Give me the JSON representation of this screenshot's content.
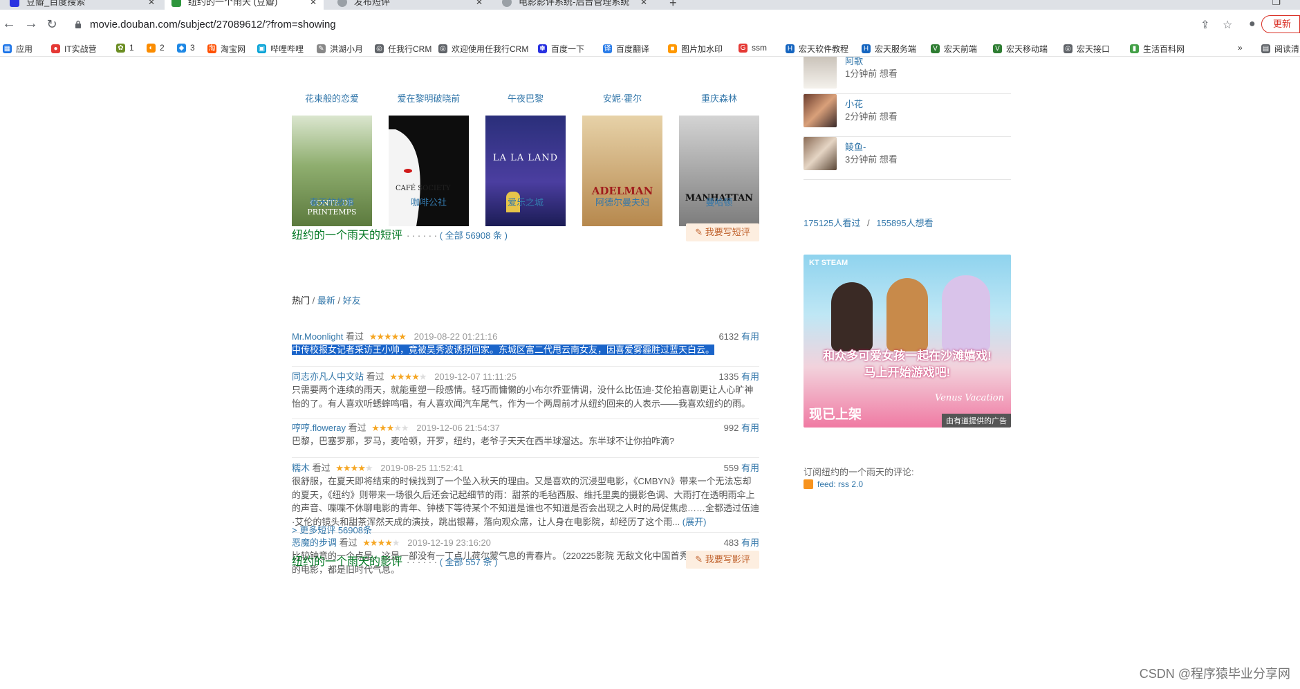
{
  "browser": {
    "tabs": [
      {
        "title": "豆瓣_百度搜索",
        "fav_color": "#2932e1"
      },
      {
        "title": "纽约的一个雨天 (豆瓣)",
        "fav_color": "#2e963d"
      },
      {
        "title": "发布短评",
        "fav_color": "#5f6368"
      },
      {
        "title": "电影影评系统-后台管理系统",
        "fav_color": "#5f6368"
      }
    ],
    "url": "movie.douban.com/subject/27089612/?from=showing",
    "update_label": "更新",
    "bookmarks": [
      {
        "label": "应用",
        "color": "#1a73e8",
        "glyph": "▦"
      },
      {
        "label": "IT实战营",
        "color": "#e53935",
        "glyph": "●"
      },
      {
        "label": "1",
        "color": "#6b8e23",
        "glyph": "✿"
      },
      {
        "label": "2",
        "color": "#fb8c00",
        "glyph": "◐"
      },
      {
        "label": "3",
        "color": "#1e88e5",
        "glyph": "◆"
      },
      {
        "label": "淘宝网",
        "color": "#ff5000",
        "glyph": "淘"
      },
      {
        "label": "哔哩哔哩",
        "color": "#00a1d6",
        "glyph": "▣"
      },
      {
        "label": "洪湖小月",
        "color": "#888888",
        "glyph": "✎"
      },
      {
        "label": "任我行CRM",
        "color": "#5f6368",
        "glyph": "◎"
      },
      {
        "label": "欢迎使用任我行CRM",
        "color": "#5f6368",
        "glyph": "◎"
      },
      {
        "label": "百度一下",
        "color": "#2932e1",
        "glyph": "✽"
      },
      {
        "label": "百度翻译",
        "color": "#2b7de9",
        "glyph": "译"
      },
      {
        "label": "图片加水印",
        "color": "#ff9800",
        "glyph": "■"
      },
      {
        "label": "ssm",
        "color": "#e53935",
        "glyph": "G"
      },
      {
        "label": "宏天软件教程",
        "color": "#1565c0",
        "glyph": "H"
      },
      {
        "label": "宏天服务端",
        "color": "#1565c0",
        "glyph": "H"
      },
      {
        "label": "宏天前端",
        "color": "#2e7d32",
        "glyph": "V"
      },
      {
        "label": "宏天移动端",
        "color": "#2e7d32",
        "glyph": "V"
      },
      {
        "label": "宏天接口",
        "color": "#5f6368",
        "glyph": "◎"
      },
      {
        "label": "生活百科网",
        "color": "#43a047",
        "glyph": "▮"
      }
    ],
    "bookmarks_more": "»",
    "reading_list": "阅读清"
  },
  "posters_row1": [
    "花束般的恋爱",
    "爱在黎明破晓前",
    "午夜巴黎",
    "安妮·霍尔",
    "重庆森林"
  ],
  "posters_row2": [
    {
      "title": "春天的故事",
      "art": "CONTE DE PRINTEMPS",
      "bg": "#6b8e4e"
    },
    {
      "title": "咖啡公社",
      "art": "CAFÉ SOCIETY",
      "bg": "#111111"
    },
    {
      "title": "爱乐之城",
      "art": "LA LA LAND",
      "bg": "#2b2d8a"
    },
    {
      "title": "阿德尔曼夫妇",
      "art": "ADELMAN",
      "bg": "#c9a46a"
    },
    {
      "title": "曼哈顿",
      "art": "MANHATTAN",
      "bg": "#9a9a9a"
    }
  ],
  "short_reviews": {
    "title": "纽约的一个雨天的短评",
    "dots": "· · · · · ·",
    "count_label": "( 全部 56908 条 )",
    "write_button": "我要写短评",
    "tabs": [
      "热门",
      "最新",
      "好友"
    ],
    "items": [
      {
        "user": "Mr.Moonlight",
        "action": "看过",
        "stars": 5,
        "time": "2019-08-22 01:21:16",
        "votes": "6132",
        "useful": "有用",
        "text": "中传校报女记者采访王小帅，竟被吴秀波诱拐回家。东城区富二代甩云南女友，因喜爱雾霾胜过蓝天白云。",
        "highlighted": true
      },
      {
        "user": "同志亦凡人中文站",
        "action": "看过",
        "stars": 4,
        "time": "2019-12-07 11:11:25",
        "votes": "1335",
        "useful": "有用",
        "text": "只需要两个连续的雨天，就能重塑一段感情。轻巧而慵懒的小布尔乔亚情调，没什么比伍迪·艾伦拍喜剧更让人心旷神怡的了。有人喜欢听蟋蟀鸣唱，有人喜欢闻汽车尾气，作为一个两周前才从纽约回来的人表示——我喜欢纽约的雨。"
      },
      {
        "user": "哼哼.floweray",
        "action": "看过",
        "stars": 3,
        "time": "2019-12-06 21:54:37",
        "votes": "992",
        "useful": "有用",
        "text": "巴黎，巴塞罗那，罗马，麦哈顿，开罗，纽约，老爷子天天在西半球溜达。东半球不让你拍咋滴?"
      },
      {
        "user": "糯木",
        "action": "看过",
        "stars": 4,
        "time": "2019-08-25 11:52:41",
        "votes": "559",
        "useful": "有用",
        "text": "很舒服，在夏天即将结束的时候找到了一个坠入秋天的理由。又是喜欢的沉浸型电影，《CMBYN》带来一个无法忘却的夏天，《纽约》则带来一场很久后还会记起细节的雨：甜茶的毛毡西服、维托里奥的摄影色调、大雨打在透明雨伞上的声音、喋喋不休聊电影的青年、钟楼下等待某个不知道是谁也不知道是否会出现之人时的局促焦虑……全都透过伍迪·艾伦的镜头和甜茶浑然天成的演技，跳出银幕，落向观众席，让人身在电影院，却经历了这个雨...",
        "expand": "(展开)"
      },
      {
        "user": "恶魔的步调",
        "action": "看过",
        "stars": 4,
        "time": "2019-12-19 23:16:20",
        "votes": "483",
        "useful": "有用",
        "text": "比较钟意的一个点是，这是一部没有一丁点儿荷尔蒙气息的青春片。（220225影院 无敌文化中国首秀……不管拍多新的电影，都是旧时代气息。"
      }
    ],
    "more_link": "> 更多短评 56908条"
  },
  "long_reviews": {
    "title": "纽约的一个雨天的影评",
    "dots": "· · · · · ·",
    "count_label": "( 全部 557 条 )",
    "write_button": "我要写影评"
  },
  "aside": {
    "users": [
      {
        "name": "阿歌",
        "ago": "1分钟前 想看"
      },
      {
        "name": "小花",
        "ago": "2分钟前 想看"
      },
      {
        "name": "鲮鱼-",
        "ago": "3分钟前 想看"
      }
    ],
    "watched": "175125人看过",
    "sep": "/",
    "wish": "155895人想看",
    "ad": {
      "logos": "KT  STEAM",
      "headline_1": "和众多可爱女孩一起在沙滩嬉戏!",
      "headline_2": "马上开始游戏吧!",
      "tag": "现已上架",
      "brand": "Venus Vacation",
      "note": "由有道提供的广告"
    },
    "subscribe_label": "订阅纽约的一个雨天的评论:",
    "rss_label": "feed: rss 2.0"
  },
  "watermark": "CSDN @程序猿毕业分享网"
}
